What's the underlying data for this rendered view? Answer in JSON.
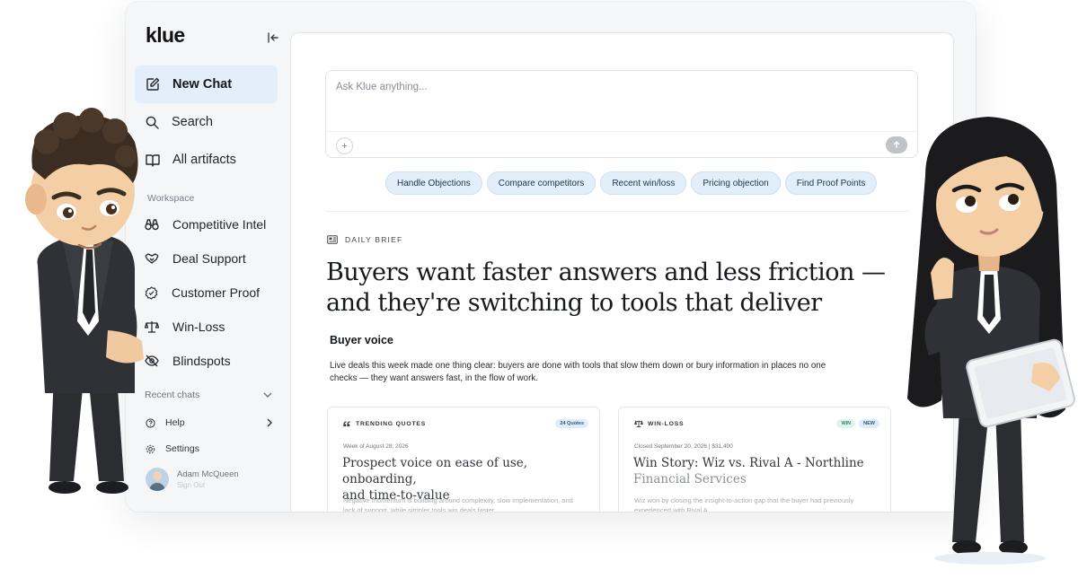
{
  "sidebar": {
    "logo": "klue",
    "new_chat": "New Chat",
    "search": "Search",
    "artifacts": "All artifacts",
    "workspace_label": "Workspace",
    "workspace": [
      {
        "label": "Competitive Intel",
        "icon": "binoculars-icon"
      },
      {
        "label": "Deal Support",
        "icon": "handshake-icon"
      },
      {
        "label": "Customer Proof",
        "icon": "badge-check-icon"
      },
      {
        "label": "Win-Loss",
        "icon": "scale-icon"
      },
      {
        "label": "Blindspots",
        "icon": "eye-off-icon"
      }
    ],
    "recent_chats": "Recent chats",
    "help": "Help",
    "settings": "Settings",
    "user": {
      "name": "Adam McQueen",
      "sub": "Sign Out"
    }
  },
  "chat": {
    "placeholder": "Ask Klue anything...",
    "chips": [
      "Handle Objections",
      "Compare competitors",
      "Recent win/loss",
      "Pricing objection",
      "Find Proof Points"
    ]
  },
  "brief": {
    "label": "DAILY BRIEF",
    "headline": "Buyers want faster answers and less friction — and they're switching to tools that deliver",
    "section": "Buyer voice",
    "paragraph": "Live deals this week made one thing clear: buyers are done with tools that slow them down or bury information in places no one checks — they want answers fast, in the flow of work."
  },
  "cards": [
    {
      "tag": "TRENDING QUOTES",
      "badges": [
        "24 Quotes"
      ],
      "meta": "Week of August 28, 2026",
      "title_main": "Prospect voice on ease of use, onboarding,",
      "title_muted": "and time-to-value",
      "desc": "Negative momentum is building around complexity, slow implementation, and lack of support, while simpler tools win deals faster."
    },
    {
      "tag": "WIN-LOSS",
      "badges": [
        "WIN",
        "NEW"
      ],
      "meta": "Closed September 20, 2026  |  $31,400",
      "title_main": "Win Story: Wiz vs. Rival A - Northline",
      "title_muted": "Financial Services",
      "desc": "Wiz won by closing the insight-to-action gap that the buyer had previously experienced with Rival A."
    }
  ],
  "colors": {
    "accent_active": "#e2eefa",
    "chip_bg": "#e3eefb",
    "badge_win": "#dff4ec"
  }
}
